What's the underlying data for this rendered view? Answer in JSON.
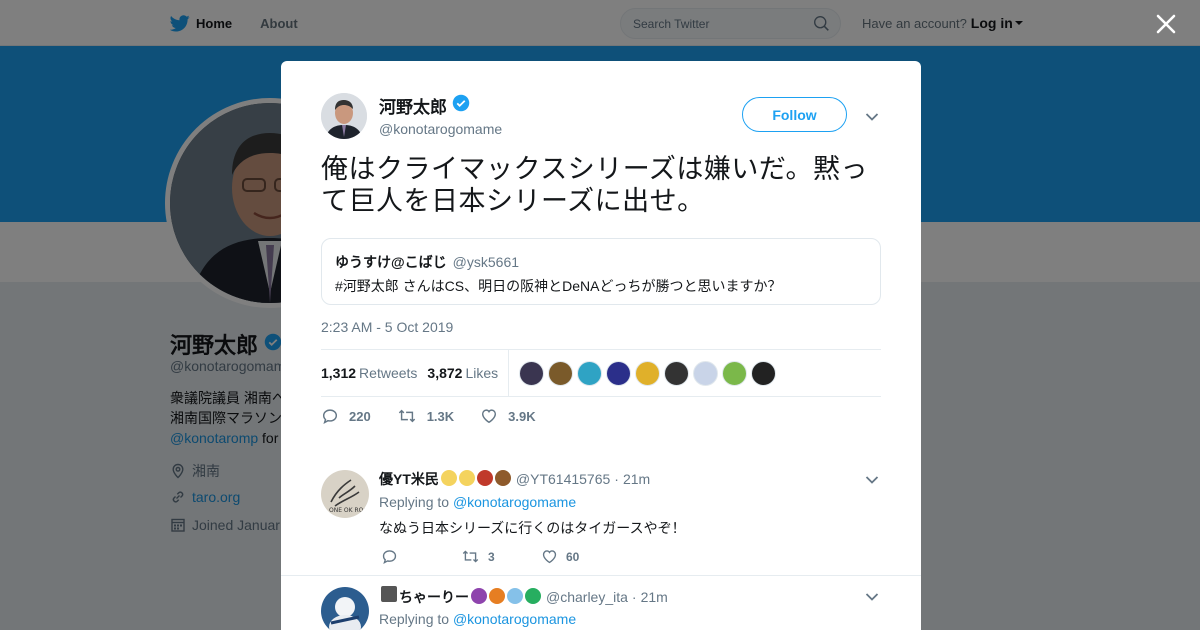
{
  "nav": {
    "home_label": "Home",
    "about_label": "About",
    "search_placeholder": "Search Twitter",
    "have_account": "Have an account?",
    "login_label": "Log in"
  },
  "profile": {
    "name": "河野太郎",
    "handle": "@konotarogomam",
    "bio_line1": "衆議院議員 湘南へ",
    "bio_line2": "湘南国際マラソン",
    "bio_link": "@konotaromp",
    "bio_link_suffix": " for",
    "location": "湘南",
    "website": "taro.org",
    "joined": "Joined Januar"
  },
  "tweet": {
    "author_name": "河野太郎",
    "author_handle": "@konotarogomame",
    "follow_label": "Follow",
    "text": "俺はクライマックスシリーズは嫌いだ。黙って巨人を日本シリーズに出せ。",
    "quote": {
      "name": "ゆうすけ@こばじ",
      "handle": "@ysk5661",
      "text": "#河野太郎 さんはCS、明日の阪神とDeNAどっちが勝つと思いますか？"
    },
    "timestamp": "2:23 AM - 5 Oct 2019",
    "retweets_count": "1,312",
    "retweets_label": "Retweets",
    "likes_count": "3,872",
    "likes_label": "Likes",
    "reply_count": "220",
    "retweet_count_short": "1.3K",
    "like_count_short": "3.9K",
    "liker_colors": [
      "#3a3550",
      "#7a5a2a",
      "#2fa3c4",
      "#2b2f8a",
      "#e0b02a",
      "#333333",
      "#c9d4e8",
      "#7bb84a",
      "#222222"
    ]
  },
  "replies": [
    {
      "name": "優YT米民",
      "handle": "@YT61415765",
      "time": "21m",
      "replying_prefix": "Replying to",
      "replying_to": "@konotarogomame",
      "text": "なぬう日本シリーズに行くのはタイガースやぞ！",
      "reply_count": "",
      "retweet_count": "3",
      "like_count": "60",
      "emoji_colors": [
        "#f4d35e",
        "#f4d35e",
        "#c0392b",
        "#8e5a2b"
      ]
    },
    {
      "name": "ちゃーりー",
      "handle": "@charley_ita",
      "time": "21m",
      "replying_prefix": "Replying to",
      "replying_to": "@konotarogomame",
      "emoji_colors": [
        "#555555",
        "#8e44ad",
        "#e67e22",
        "#85c1e9",
        "#27ae60"
      ]
    }
  ],
  "colors": {
    "accent": "#1da1f2",
    "link": "#1b95e0",
    "muted": "#657786"
  }
}
